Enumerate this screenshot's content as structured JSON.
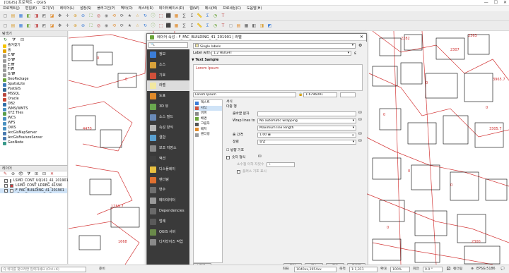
{
  "window": {
    "title": "[QGIS] 프로젝트 - QGIS",
    "min": "—",
    "max": "☐",
    "close": "✕"
  },
  "menubar": [
    "프로젝트(J)",
    "편집(E)",
    "보기(V)",
    "레이어(L)",
    "설정(S)",
    "플러그인(P)",
    "벡터(O)",
    "래스터(R)",
    "데이터베이스(D)",
    "웹(W)",
    "메시(M)",
    "프로세싱(C)",
    "도움말(H)"
  ],
  "browser": {
    "title": "탐색기",
    "items": [
      {
        "label": "즐겨찾기",
        "icon": "star-icon",
        "color": "#f5c400"
      },
      {
        "label": "홈",
        "icon": "home-icon",
        "color": "#e3a400"
      },
      {
        "label": "C:₩",
        "icon": "drive-icon",
        "color": "#9a9a9a"
      },
      {
        "label": "D:₩",
        "icon": "drive-icon",
        "color": "#9a9a9a"
      },
      {
        "label": "E:₩",
        "icon": "drive-icon",
        "color": "#9a9a9a"
      },
      {
        "label": "F:₩",
        "icon": "drive-icon",
        "color": "#9a9a9a"
      },
      {
        "label": "G:₩",
        "icon": "drive-icon",
        "color": "#9a9a9a"
      },
      {
        "label": "GeoPackage",
        "icon": "geopackage-icon",
        "color": "#6ba539"
      },
      {
        "label": "SpatiaLite",
        "icon": "spatialite-icon",
        "color": "#3d7ab8"
      },
      {
        "label": "PostGIS",
        "icon": "postgis-icon",
        "color": "#336791"
      },
      {
        "label": "MSSQL",
        "icon": "mssql-icon",
        "color": "#b8473d"
      },
      {
        "label": "Oracle",
        "icon": "oracle-icon",
        "color": "#c74634"
      },
      {
        "label": "DB2",
        "icon": "db2-icon",
        "color": "#2f6ea8"
      },
      {
        "label": "WMS/WMTS",
        "icon": "wms-icon",
        "color": "#4a90c0"
      },
      {
        "label": "XYZ Tiles",
        "icon": "xyz-icon",
        "color": "#5a9e4a"
      },
      {
        "label": "WCS",
        "icon": "wcs-icon",
        "color": "#4a90c0"
      },
      {
        "label": "WFS",
        "icon": "wfs-icon",
        "color": "#4a90c0"
      },
      {
        "label": "OWS",
        "icon": "ows-icon",
        "color": "#4a90c0"
      },
      {
        "label": "ArcGisMapServer",
        "icon": "arcgis-icon",
        "color": "#4a7ab0"
      },
      {
        "label": "ArcGisFeatureServer",
        "icon": "arcgis-icon",
        "color": "#4a7ab0"
      },
      {
        "label": "GeoNode",
        "icon": "geonode-icon",
        "color": "#3a9a8a"
      }
    ]
  },
  "layers": {
    "title": "레이어",
    "items": [
      {
        "label": "LSMD_CONT_UQ161_41_201901",
        "checked": true,
        "color": "#e8d070"
      },
      {
        "label": "LSMD_CONT_LDREG_41590",
        "checked": true,
        "color": "#d04040"
      },
      {
        "label": "F_FAC_BUILDING_41_201901",
        "checked": true,
        "color": "#f0f0f0"
      }
    ]
  },
  "statusbar": {
    "search_placeholder": "Q 위치를 찾으려면 입력하세요 (Ctrl+K)",
    "ready": "준비",
    "coord_label": "좌표",
    "coord_value": "1040xx,1954xx",
    "scale_label": "축척",
    "scale_value": "1:1,311",
    "magnifier_label": "확대",
    "magnifier_value": "100%",
    "rotation_label": "회전",
    "rotation_value": "0.0 °",
    "render_label": "렌더링",
    "crs": "EPSG:5186"
  },
  "dialog": {
    "title": "레이어 속성 - F_FAC_BUILDING_41_201901 | 라벨",
    "nav": [
      {
        "label": "정보",
        "icon": "info-icon",
        "color": "#3b7dd8"
      },
      {
        "label": "소스",
        "icon": "source-icon",
        "color": "#d9a23a"
      },
      {
        "label": "기호",
        "icon": "symbology-icon",
        "color": "#d0503a"
      },
      {
        "label": "라벨",
        "icon": "labels-icon",
        "color": "#f2e8a0"
      },
      {
        "label": "도표",
        "icon": "diagram-icon",
        "color": "#e08a2a"
      },
      {
        "label": "3D 뷰",
        "icon": "3d-view-icon",
        "color": "#6aa84f"
      },
      {
        "label": "소스 필드",
        "icon": "fields-icon",
        "color": "#6a8ab8"
      },
      {
        "label": "속성 양식",
        "icon": "form-icon",
        "color": "#b8b8b8"
      },
      {
        "label": "결합",
        "icon": "join-icon",
        "color": "#5aa0d0"
      },
      {
        "label": "보조 저장소",
        "icon": "storage-icon",
        "color": "#8a8a8a"
      },
      {
        "label": "액션",
        "icon": "action-icon",
        "color": "#404040"
      },
      {
        "label": "디스플레이",
        "icon": "display-icon",
        "color": "#e8c040"
      },
      {
        "label": "렌더링",
        "icon": "rendering-icon",
        "color": "#e07030"
      },
      {
        "label": "변수",
        "icon": "variable-icon",
        "color": "#707070"
      },
      {
        "label": "메타데이터",
        "icon": "metadata-icon",
        "color": "#9a9a9a"
      },
      {
        "label": "Dependencies",
        "icon": "dependencies-icon",
        "color": "#6a6a6a"
      },
      {
        "label": "범례",
        "icon": "legend-icon",
        "color": "#5a5a5a"
      },
      {
        "label": "QGIS 서버",
        "icon": "server-icon",
        "color": "#6a8a4a"
      },
      {
        "label": "디지타이즈 작업",
        "icon": "digitizing-icon",
        "color": "#8a8a8a"
      }
    ],
    "mode_value": "Single labels",
    "label_with_text": "Label with",
    "label_with_value": "1.2 HEIGHT",
    "text_sample_title": "Text Sample",
    "sample_preview": "Lorem Ipsum",
    "sample_input": "Lorem Ipsum",
    "sample_scale": "1:6796091",
    "sub_tabs": [
      "텍스트",
      "서식",
      "버퍼",
      "배경",
      "그림자",
      "배치",
      "렌더링"
    ],
    "section_title": "서식",
    "subsection_title": "다중 행",
    "wrap_char_label": "줄바꿈 문자",
    "wrap_lines_label": "Wrap lines to",
    "wrap_lines_value": "No automatic wrapping",
    "max_line_value": "Maximum line length",
    "line_height_label": "줄 간격",
    "line_height_value": "1.00 줄",
    "align_label": "정렬",
    "align_value": "중앙",
    "direction_label": "☐ 방향 기호",
    "numeric_label": "숫자 형식",
    "decimal_label": "소수점 이하 자릿수",
    "decimal_value": "1",
    "plus_label": "플러스 기호 표시",
    "style_button": "스타일",
    "ok": "확인",
    "cancel": "취소",
    "apply": "적용",
    "help": "도움말"
  },
  "map": {
    "labels": [
      "2363",
      "2307",
      "2282",
      "0",
      "0",
      "0",
      "3965.7",
      "3305.7",
      "1759.7",
      "1668",
      "4470",
      "0",
      "0",
      "0",
      "2300",
      "0",
      "0"
    ]
  }
}
